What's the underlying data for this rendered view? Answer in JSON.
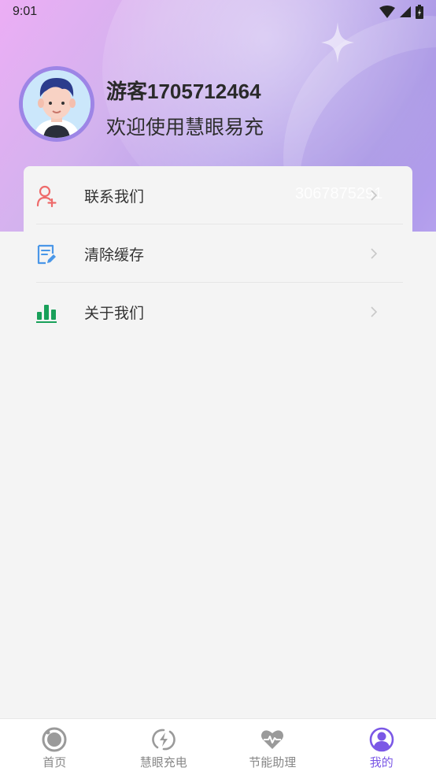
{
  "status_bar": {
    "time": "9:01"
  },
  "profile": {
    "user_name": "游客1705712464",
    "welcome_text": "欢迎使用慧眼易充"
  },
  "menu": {
    "items": [
      {
        "label": "联系我们",
        "extra": "3067875291",
        "icon": "contact-add-icon",
        "color": "#ee6b6b"
      },
      {
        "label": "清除缓存",
        "icon": "clear-cache-icon",
        "color": "#4a97e8"
      },
      {
        "label": "关于我们",
        "icon": "bar-chart-icon",
        "color": "#19a05a"
      }
    ]
  },
  "tabbar": {
    "active_color": "#7b58e6",
    "tabs": [
      {
        "label": "首页",
        "icon": "home-icon"
      },
      {
        "label": "慧眼充电",
        "icon": "charge-icon"
      },
      {
        "label": "节能助理",
        "icon": "heart-pulse-icon"
      },
      {
        "label": "我的",
        "icon": "profile-icon",
        "active": true
      }
    ]
  }
}
